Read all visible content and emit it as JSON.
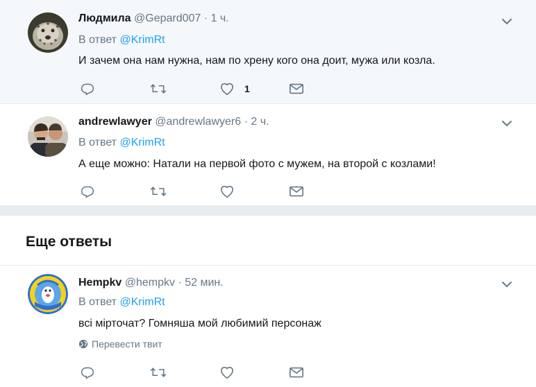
{
  "tweets": [
    {
      "name": "Людмила",
      "handle": "@Gepard007",
      "separator": "·",
      "time": "1 ч.",
      "reply_prefix": "В ответ",
      "reply_to": "@KrimRt",
      "text": "И зачем она нам нужна, нам по хрену кого она доит, мужа или козла.",
      "like_count": "1",
      "avatar_icon": "leopard-avatar"
    },
    {
      "name": "andrewlawyer",
      "handle": "@andrewlawyer6",
      "separator": "·",
      "time": "2 ч.",
      "reply_prefix": "В ответ",
      "reply_to": "@KrimRt",
      "text": "А еще можно: Натали на первой фото с мужем, на второй с козлами!",
      "avatar_icon": "two-men-photo-avatar"
    },
    {
      "name": "Hempkv",
      "handle": "@hempkv",
      "separator": "·",
      "time": "52 мин.",
      "reply_prefix": "В ответ",
      "reply_to": "@KrimRt",
      "text": "всі мірточат? Гомняша мой любимий персонаж",
      "translate_label": "Перевести твит",
      "avatar_icon": "cartoon-badge-avatar"
    }
  ],
  "more_replies_title": "Еще ответы",
  "colors": {
    "accent": "#1da1f2",
    "muted": "#657786",
    "text": "#14171a",
    "highlight_bg": "#f5f8fa",
    "divider": "#e6ecf0"
  },
  "icons": [
    "reply-icon",
    "retweet-icon",
    "like-icon",
    "message-icon",
    "chevron-down-icon",
    "globe-icon"
  ]
}
